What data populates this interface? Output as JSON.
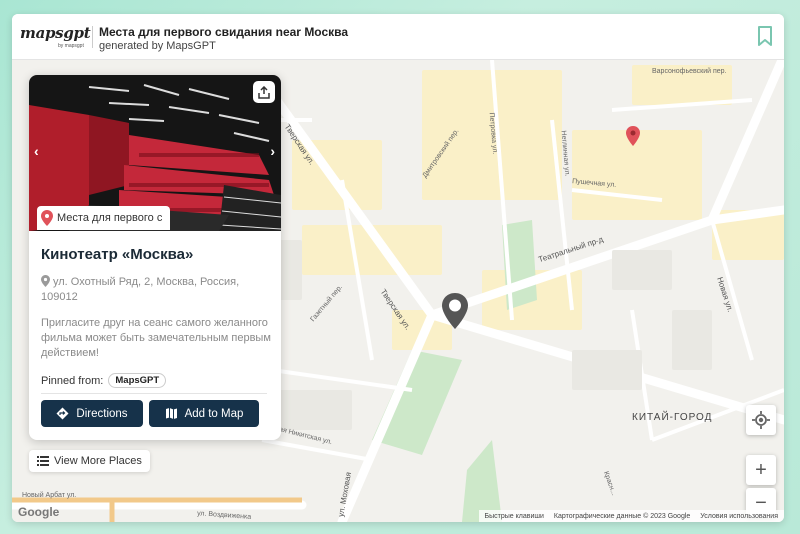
{
  "header": {
    "logo_text": "mapsgpt",
    "logo_sub": "by mapsgpt",
    "title": "Места для первого свидания near Москва",
    "subtitle": "generated by MapsGPT"
  },
  "card": {
    "chip_label": "Места для первого с",
    "place_name": "Кинотеатр «Москва»",
    "address": "ул. Охотный Ряд, 2, Москва, Россия, 109012",
    "description": "Пригласите друг на сеанс самого желанного фильма может быть замечательным первым действием!",
    "pinned_from_label": "Pinned from:",
    "pinned_source": "MapsGPT",
    "directions_label": "Directions",
    "add_to_map_label": "Add to Map"
  },
  "view_more_label": "View More Places",
  "map": {
    "streets": {
      "tverskaya_1": "Тверская ул.",
      "tverskaya_2": "Тверская ул.",
      "teatralny": "Театральный пр-д",
      "novaya": "Новая ул.",
      "mokhovaya": "ул. Моховая",
      "novy_arbat": "Новый Арбат ул.",
      "vozdvizhenka": "ул. Воздвиженка",
      "bolshaya_nikitskaya": "Большая Никитская ул.",
      "gazetny": "Газетный пер.",
      "pushechnaya": "Пушечная ул.",
      "petrovka": "Петровка ул.",
      "neglinnaya": "Неглинная ул.",
      "dmitrovsky": "Дмитровский пер.",
      "varsonofyevsky": "Варсонофьевский пер.",
      "krasnaya": "Красн..."
    },
    "district": "КИТАЙ-ГОРОД",
    "google_logo": "Google",
    "footer": {
      "shortcuts": "Быстрые клавиши",
      "map_data": "Картографические данные © 2023 Google",
      "terms": "Условия использования"
    },
    "zoom_in": "+",
    "zoom_out": "−"
  },
  "icons": {
    "bookmark": "bookmark-icon",
    "share": "share-icon",
    "pin": "map-pin-icon",
    "directions": "directions-icon",
    "add_map": "map-icon",
    "list": "list-icon",
    "locate": "locate-icon"
  },
  "colors": {
    "brand_dark": "#16324a",
    "pin_red": "#e0525a",
    "pin_dark": "#555555",
    "park_green": "#cde8c9"
  }
}
